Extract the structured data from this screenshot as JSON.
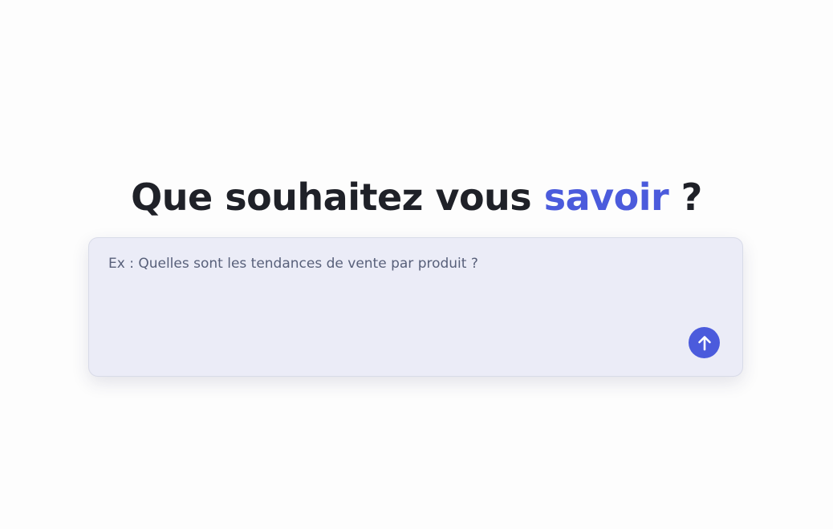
{
  "heading": {
    "prefix": "Que souhaitez vous ",
    "highlight": "savoir",
    "suffix": " ?"
  },
  "query": {
    "placeholder": "Ex : Quelles sont les tendances de vente par produit ?",
    "value": ""
  },
  "submit": {
    "icon": "arrow-up-icon"
  },
  "colors": {
    "accent": "#4b5bdc",
    "heading_text": "#1f2128",
    "input_background": "#ebecf7",
    "placeholder_text": "#58607a"
  }
}
